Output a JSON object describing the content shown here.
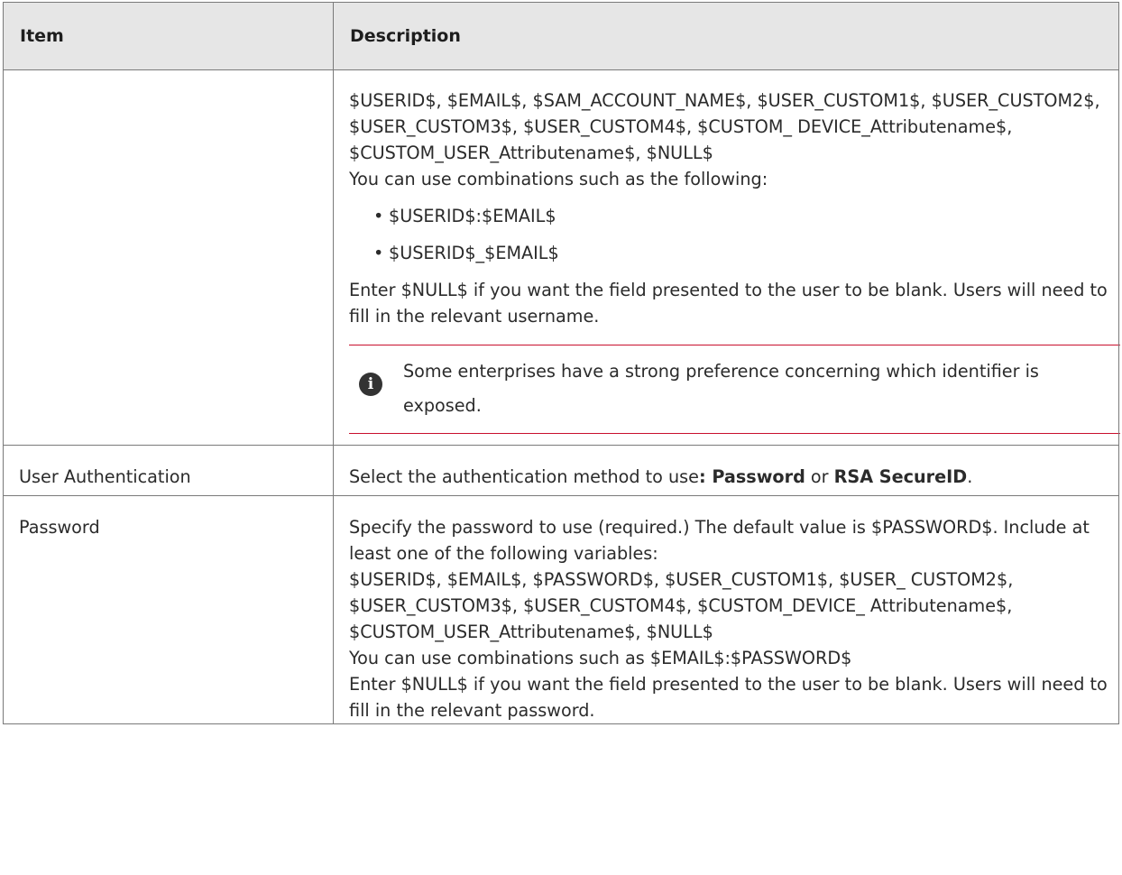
{
  "table": {
    "headers": {
      "item": "Item",
      "description": "Description"
    },
    "row1": {
      "item": "",
      "variables": "$USERID$, $EMAIL$, $SAM_ACCOUNT_NAME$, $USER_CUSTOM1$, $USER_CUSTOM2$, $USER_CUSTOM3$, $USER_CUSTOM4$, $CUSTOM_ DEVICE_Attributename$, $CUSTOM_USER_Attributename$, $NULL$",
      "combinations_intro": "You can use combinations such as the following:",
      "bullet_char": "•",
      "bullets": [
        "$USERID$:$EMAIL$",
        "$USERID$_$EMAIL$"
      ],
      "null_note": "Enter $NULL$ if you want the field presented to the user to be blank. Users will need to fill in the relevant username.",
      "info_icon_glyph": "i",
      "info_note": "Some enterprises have a strong preference concerning which identifier is exposed."
    },
    "row2": {
      "item": "User Authentication",
      "desc_prefix": "Select the authentication method to use",
      "desc_colon": ": ",
      "option1": "Password",
      "desc_or": " or ",
      "option2": "RSA SecureID",
      "desc_suffix": "."
    },
    "row3": {
      "item": "Password",
      "p1": "Specify the password to use (required.) The default value is $PASSWORD$. Include at least one of the following variables:",
      "p2": "$USERID$, $EMAIL$, $PASSWORD$, $USER_CUSTOM1$, $USER_ CUSTOM2$, $USER_CUSTOM3$, $USER_CUSTOM4$, $CUSTOM_DEVICE_ Attributename$, $CUSTOM_USER_Attributename$, $NULL$",
      "p3": "You can use combinations such as $EMAIL$:$PASSWORD$",
      "p4": "Enter $NULL$ if you want the field presented to the user to be blank. Users will need to fill in the relevant password."
    }
  },
  "colors": {
    "header_bg": "#e6e6e6",
    "border": "#7a7a7a",
    "note_rule": "#c8102e",
    "icon_bg": "#333333"
  }
}
